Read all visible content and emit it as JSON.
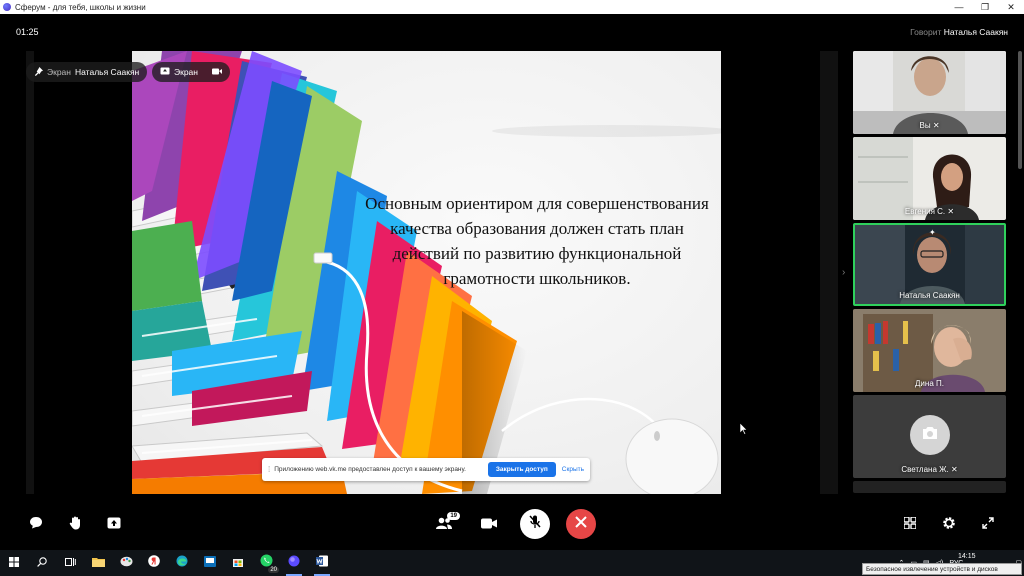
{
  "window": {
    "title": "Сферум - для тебя, школы и жизни",
    "minimize_glyph": "—",
    "restore_glyph": "❐",
    "close_glyph": "✕"
  },
  "call": {
    "timer": "01:25",
    "speaking_label": "Говорит",
    "speaking_name": "Наталья Саакян"
  },
  "screen_pills": {
    "pinned_label": "Экран",
    "pinned_name": "Наталья Саакян",
    "screen_label": "Экран"
  },
  "slide": {
    "text": "Основным ориентиром для совершенствования качества образования должен стать план действий по развитию функциональной грамотности школьников."
  },
  "share_banner": {
    "grip": "⁞",
    "message": "Приложению web.vk.me предоставлен доступ к вашему экрану.",
    "stop_button": "Закрыть доступ",
    "hide_link": "Скрыть"
  },
  "participants": [
    {
      "name": "Вы",
      "muted": true,
      "active": false
    },
    {
      "name": "Евгения С.",
      "muted": true,
      "active": false
    },
    {
      "name": "Наталья Саакян",
      "muted": false,
      "active": true
    },
    {
      "name": "Дина П.",
      "muted": false,
      "active": false
    },
    {
      "name": "Светлана Ж.",
      "muted": true,
      "active": false
    }
  ],
  "controls": {
    "participants_count": "19"
  },
  "taskbar": {
    "whatsapp_badge": "20",
    "lang": "РУС",
    "clock": "14:15",
    "tooltip": "Безопасное извлечение устройств и дисков"
  },
  "colors": {
    "active_speaker": "#2fd15c",
    "end_call": "#e64646",
    "share_button": "#1a73e8"
  }
}
